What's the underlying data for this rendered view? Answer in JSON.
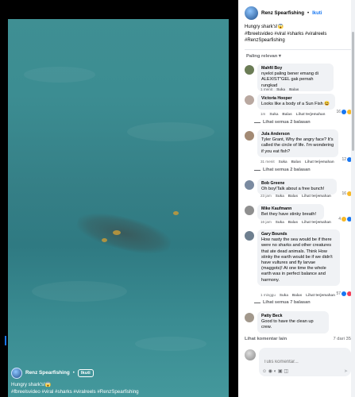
{
  "video": {
    "author": "Renz Spearfishing",
    "dot": "•",
    "follow_label": "Ikuti",
    "caption": "Hungry shark's!😱",
    "hashtags": "#fbreelsvideo #viral #sharks #viralreels #RenzSpearfishing"
  },
  "panel": {
    "author": "Renz Spearfishing",
    "dot": "•",
    "follow_label": "Ikuti",
    "caption": "Hungry shark's!😱",
    "hashtags_line1": "#fbreelsvideo #viral #sharks #viralreels",
    "hashtags_line2": "#RenzSpearfishing",
    "sort_label": "Paling relevan ▾",
    "load_more": "Lihat komentar lain",
    "count": "7 dari 35",
    "input_placeholder": "Tulis komentar...",
    "input_tools": "☺ ◉ ◐ ▣ ◫",
    "send_icon": "➤"
  },
  "comments": [
    {
      "author": "Mahfil Boy",
      "text": "nyelot paling bener emang di ALEXIST\"GEL gak pernah rungkad",
      "time": "1 menit",
      "like": "Suka",
      "reply": "Balas",
      "translate": "",
      "reactions": ""
    },
    {
      "author": "Victoria Hooper",
      "text": "Looks like a body of a Sun Fish 😆",
      "time": "1m",
      "like": "Suka",
      "reply": "Balas",
      "translate": "Lihat terjemahan",
      "reactions": "16"
    },
    {
      "author": "Jula Anderson",
      "text": "Tyler Grant, Why the angry face? It's called the circle of life. I'm wondering if you eat fish?",
      "time": "31 menit",
      "like": "Suka",
      "reply": "Balas",
      "translate": "Lihat terjemahan",
      "reactions": "12"
    },
    {
      "author": "Bob Greene",
      "text": "Oh boy!Talk about a free bunch!",
      "time": "23 jam",
      "like": "Suka",
      "reply": "Balas",
      "translate": "Lihat terjemahan",
      "reactions": "16"
    },
    {
      "author": "Mike Kaufmann",
      "text": "Bet they have stinky breath!",
      "time": "16 jam",
      "like": "Suka",
      "reply": "Balas",
      "translate": "Lihat terjemahan",
      "reactions": "4"
    },
    {
      "author": "Gary Bounds",
      "text": "How nasty the sea would be if there were no sharks and other creatures that ate dead animals. Think How stinky the earth would be if we didn't have vultures and fly larvae (maggots)! At one time the whole earth was in perfect balance and harmony.",
      "time": "1 minggu",
      "like": "Suka",
      "reply": "Balas",
      "translate": "Lihat terjemahan",
      "reactions": "57"
    },
    {
      "author": "Patty Beck",
      "text": "Good to have the clean up crew.",
      "time": "",
      "like": "",
      "reply": "",
      "translate": "",
      "reactions": ""
    }
  ],
  "replies": [
    {
      "label": "Lihat semua 2 balasan"
    },
    {
      "label": "Lihat semua 2 balasan"
    },
    {
      "label": "Lihat semua 7 balasan"
    }
  ]
}
